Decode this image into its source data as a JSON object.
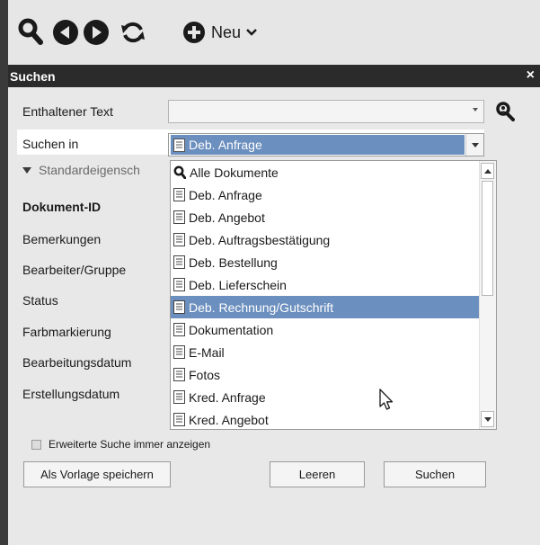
{
  "toolbar": {
    "icons": [
      "search-icon",
      "back-icon",
      "forward-icon",
      "refresh-icon",
      "plus-circle-icon"
    ],
    "new_label": "Neu",
    "new_icon": "chevron-down-icon"
  },
  "panel": {
    "title": "Suchen",
    "close_label": "×",
    "text_label": "Enthaltener Text",
    "text_value": "",
    "search_in_label": "Suchen in",
    "search_in_value": "Deb. Anfrage",
    "section_label": "Standardeigensch",
    "fields": [
      "Dokument-ID",
      "Bemerkungen",
      "Bearbeiter/Gruppe",
      "Status",
      "Farbmarkierung",
      "Bearbeitungsdatum",
      "Erstellungsdatum"
    ]
  },
  "dropdown": {
    "items": [
      "Alle Dokumente",
      "Deb. Anfrage",
      "Deb. Angebot",
      "Deb. Auftragsbestätigung",
      "Deb. Bestellung",
      "Deb. Lieferschein",
      "Deb. Rechnung/Gutschrift",
      "Dokumentation",
      "E-Mail",
      "Fotos",
      "Kred. Anfrage",
      "Kred. Angebot"
    ],
    "highlighted_index": 6
  },
  "footer": {
    "checkbox_label": "Erweiterte Suche immer anzeigen",
    "save_template": "Als Vorlage speichern",
    "clear": "Leeren",
    "search": "Suchen"
  },
  "colors": {
    "selection": "#6b8fbe",
    "titlebar": "#2b2b2b"
  }
}
